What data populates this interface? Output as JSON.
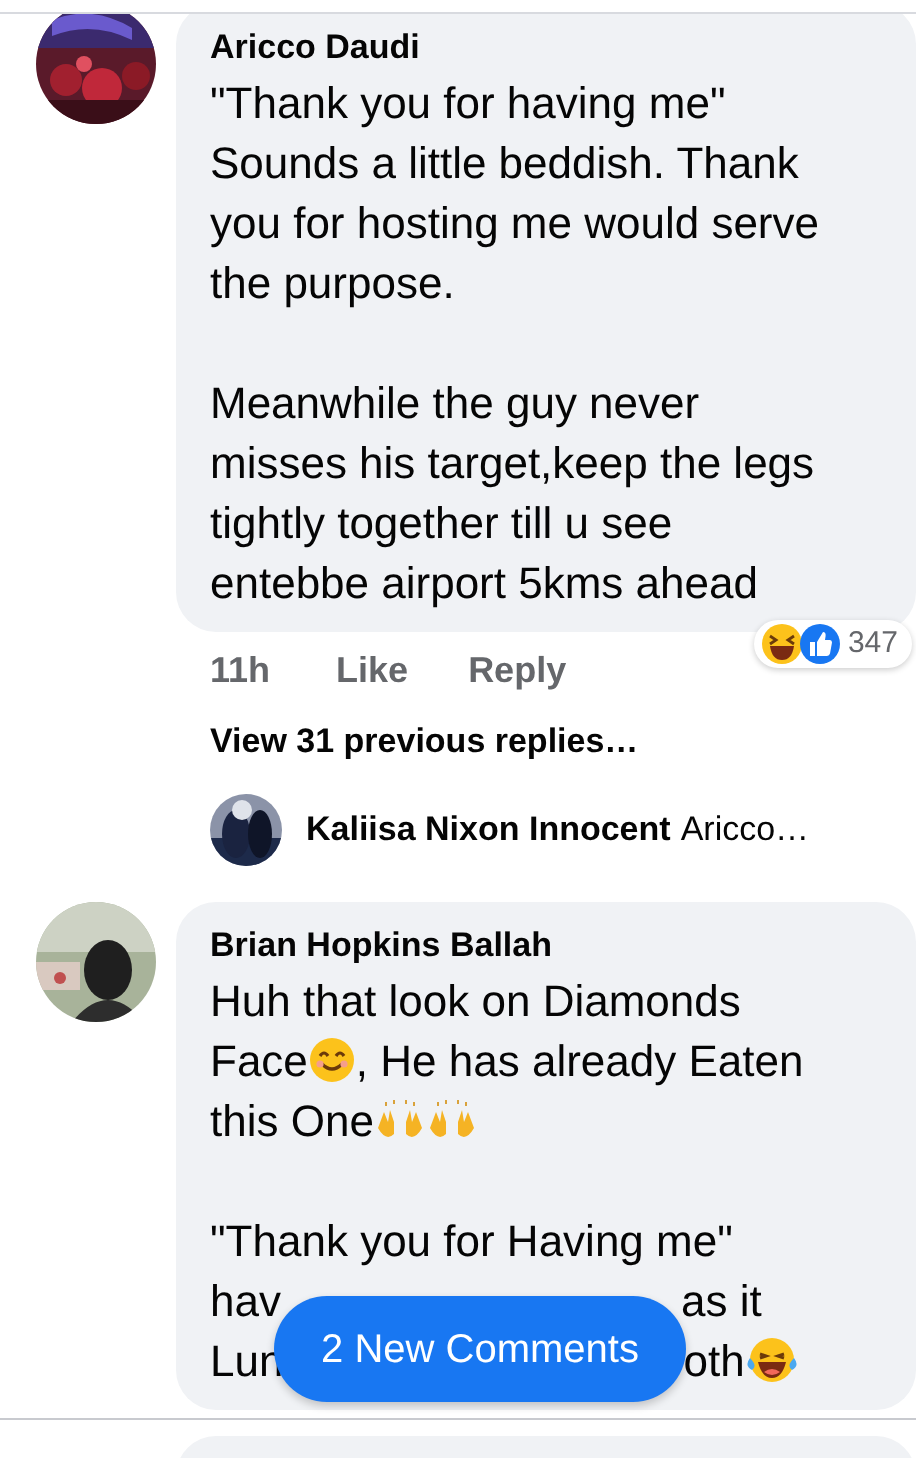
{
  "comments": [
    {
      "author": "Aricco Daudi",
      "avatar": {
        "kind": "picture"
      },
      "paragraphs": [
        [
          [
            {
              "kind": "text",
              "text": "\"Thank you for having me\""
            }
          ],
          [
            {
              "kind": "text",
              "text": "Sounds a little beddish. Thank"
            }
          ],
          [
            {
              "kind": "text",
              "text": "you for hosting me would serve"
            }
          ],
          [
            {
              "kind": "text",
              "text": "the purpose."
            }
          ]
        ],
        [
          [
            {
              "kind": "text",
              "text": "Meanwhile the guy never"
            }
          ],
          [
            {
              "kind": "text",
              "text": "misses his target,keep the legs"
            }
          ],
          [
            {
              "kind": "text",
              "text": "tightly together till u see"
            }
          ],
          [
            {
              "kind": "text",
              "text": "entebbe airport 5kms ahead"
            }
          ]
        ]
      ],
      "time": "11h",
      "actions": [
        "Like",
        "Reply"
      ],
      "reactions": {
        "items": [
          {
            "kind": "laugh"
          },
          {
            "kind": "like"
          }
        ],
        "count": "347"
      },
      "view_replies": "View 31 previous replies…",
      "latest_reply": {
        "author": "Kaliisa Nixon Innocent",
        "preview": "Aricco…"
      }
    },
    {
      "author": "Brian Hopkins Ballah",
      "avatar": {
        "kind": "picture"
      },
      "paragraphs": [
        [
          [
            {
              "kind": "text",
              "text": "Huh that look on Diamonds"
            }
          ],
          [
            {
              "kind": "text",
              "text": "Face"
            },
            {
              "kind": "smile"
            },
            {
              "kind": "text",
              "text": ", He has already Eaten"
            }
          ],
          [
            {
              "kind": "text",
              "text": "this One"
            },
            {
              "kind": "hands"
            },
            {
              "kind": "hands"
            }
          ]
        ],
        [
          [
            {
              "kind": "text",
              "text": "\"Thank you for Having me\""
            }
          ],
          [
            {
              "kind": "text",
              "text": "hav"
            },
            {
              "kind": "gap"
            },
            {
              "kind": "text",
              "text": "as it"
            }
          ],
          [
            {
              "kind": "text",
              "text": "Lun"
            },
            {
              "kind": "gap"
            },
            {
              "kind": "text",
              "text": "oth"
            },
            {
              "kind": "laugh"
            }
          ]
        ]
      ]
    }
  ],
  "new_comments_button": "2 New Comments"
}
